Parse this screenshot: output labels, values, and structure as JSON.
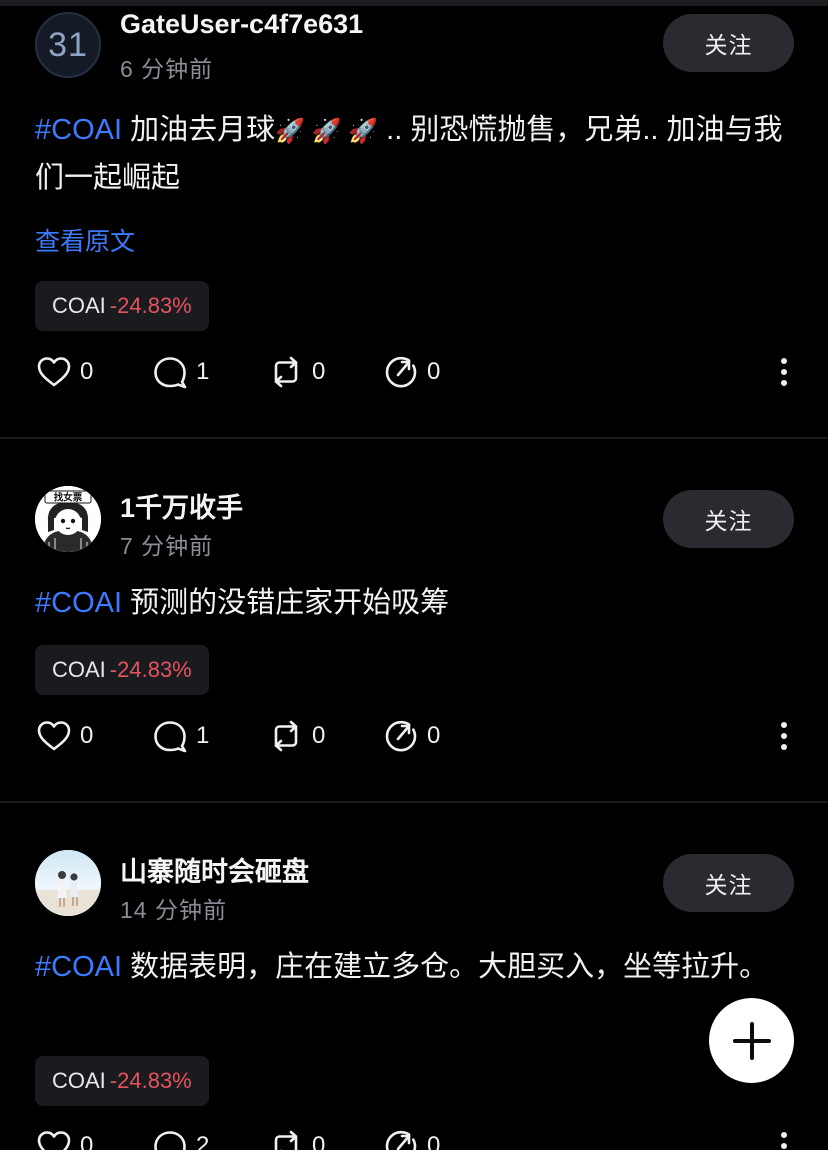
{
  "follow_label": "关注",
  "view_original_label": "查看原文",
  "posts": [
    {
      "avatar_text": "31",
      "username": "GateUser-c4f7e631",
      "time": "6 分钟前",
      "hashtag": "#COAI",
      "text_a": "加油去月球",
      "rocket_icon": "🚀 🚀 🚀",
      "text_b": ".. 别恐慌抛售，兄弟.. 加油与我们一起崛起",
      "ticker_symbol": "COAI",
      "ticker_change": "-24.83%",
      "likes": "0",
      "comments": "1",
      "reposts": "0",
      "shares": "0"
    },
    {
      "avatar_text": "找女票",
      "username": "1千万收手",
      "time": "7 分钟前",
      "hashtag": "#COAI",
      "text": "预测的没错庄家开始吸筹",
      "ticker_symbol": "COAI",
      "ticker_change": "-24.83%",
      "likes": "0",
      "comments": "1",
      "reposts": "0",
      "shares": "0"
    },
    {
      "username": "山寨随时会砸盘",
      "time": "14 分钟前",
      "hashtag": "#COAI",
      "text": "数据表明，庄在建立多仓。大胆买入，坐等拉升。",
      "ticker_symbol": "COAI",
      "ticker_change": "-24.83%",
      "likes": "0",
      "comments": "2",
      "reposts": "0",
      "shares": "0"
    }
  ],
  "icons": {
    "like": "heart-icon",
    "comment": "comment-bubble-icon",
    "repost": "repost-icon",
    "share": "share-icon",
    "more": "more-vertical-icon",
    "create": "plus-icon"
  },
  "colors": {
    "background": "#000000",
    "hashtag": "#3b7cff",
    "negative_change": "#e5525f",
    "follow_button_bg": "#2a2b30"
  }
}
